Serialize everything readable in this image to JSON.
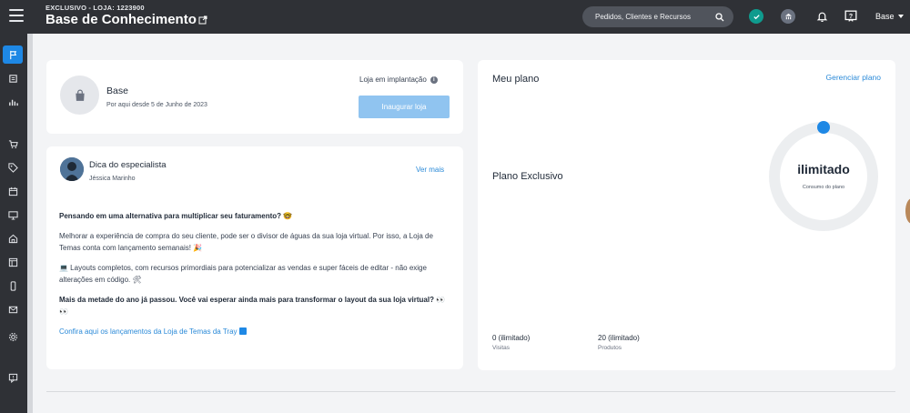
{
  "header": {
    "store_subtitle": "EXCLUSIVO - LOJA: 1223900",
    "title": "Base de Conhecimento",
    "search_placeholder": "Pedidos, Clientes e Recursos",
    "user_label": "Base"
  },
  "sidebar": {
    "items": [
      "flag-icon",
      "orders-icon",
      "reports-icon",
      "cart-icon",
      "tag-icon",
      "calendar-icon",
      "monitor-icon",
      "store-icon",
      "layout-icon",
      "mobile-icon",
      "mail-icon",
      "settings-icon",
      "feedback-icon"
    ]
  },
  "store_card": {
    "name": "Base",
    "since": "Por aqui desde 5 de Junho de 2023",
    "status": "Loja em implantação",
    "button": "Inaugurar loja"
  },
  "tip_card": {
    "title": "Dica do especialista",
    "author": "Jéssica Marinho",
    "more": "Ver mais",
    "p1": "Pensando em uma alternativa para multiplicar seu faturamento? 🤓",
    "p2": "Melhorar a experiência de compra do seu cliente, pode ser o divisor de águas da sua loja virtual. Por isso, a Loja de Temas conta com lançamento semanais! 🎉",
    "p3": "💻 Layouts completos, com recursos primordiais para potencializar as vendas e super fáceis de editar - não exige alterações em código. 🛠",
    "p4": "Mais da metade do ano já passou. Você vai esperar ainda mais para transformar o layout da sua loja virtual? 👀👀",
    "link": "Confira aqui os lançamentos da Loja de Temas da Tray"
  },
  "plan_card": {
    "title": "Meu plano",
    "manage": "Gerenciar plano",
    "plan_name": "Plano Exclusivo",
    "ring_value": "ilimitado",
    "ring_label": "Consumo do plano",
    "visits_value": "0 (ilimitado)",
    "visits_label": "Visitas",
    "products_value": "20 (ilimitado)",
    "products_label": "Produtos"
  },
  "colors": {
    "accent": "#1e88e5",
    "topbar": "#2f3136",
    "link": "#2b8ad8",
    "button_disabled": "#90c4f0"
  }
}
